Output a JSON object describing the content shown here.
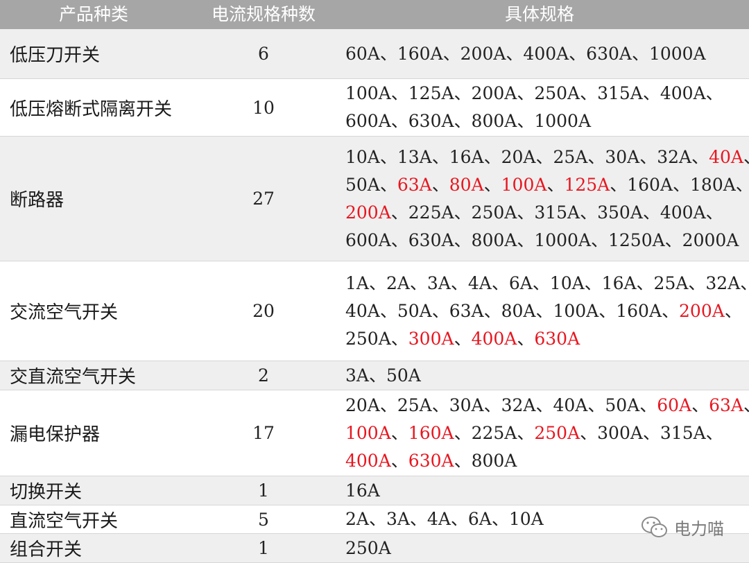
{
  "header": {
    "col_type": "产品种类",
    "col_count": "电流规格种数",
    "col_specs": "具体规格"
  },
  "rows": [
    {
      "name": "低压刀开关",
      "count": "6",
      "lines": [
        [
          [
            "60A、160A、200A、400A、630A、1000A",
            false
          ]
        ]
      ]
    },
    {
      "name": "低压熔断式隔离开关",
      "count": "10",
      "lines": [
        [
          [
            "100A、125A、200A、250A、315A、400A、",
            false
          ]
        ],
        [
          [
            "600A、630A、800A、1000A",
            false
          ]
        ]
      ]
    },
    {
      "name": "断路器",
      "count": "27",
      "lines": [
        [
          [
            "10A、13A、16A、20A、25A、30A、32A、",
            false
          ],
          [
            "40A",
            true
          ],
          [
            "、",
            false
          ]
        ],
        [
          [
            "50A、",
            false
          ],
          [
            "63A",
            true
          ],
          [
            "、",
            false
          ],
          [
            "80A",
            true
          ],
          [
            "、",
            false
          ],
          [
            "100A",
            true
          ],
          [
            "、",
            false
          ],
          [
            "125A",
            true
          ],
          [
            "、160A、180A、",
            false
          ]
        ],
        [
          [
            "200A",
            true
          ],
          [
            "、225A、250A、315A、350A、400A、",
            false
          ]
        ],
        [
          [
            "600A、630A、800A、1000A、1250A、2000A",
            false
          ]
        ]
      ]
    },
    {
      "name": "交流空气开关",
      "count": "20",
      "lines": [
        [
          [
            "1A、2A、3A、4A、6A、10A、16A、25A、32A、",
            false
          ]
        ],
        [
          [
            "40A、50A、63A、80A、100A、160A、",
            false
          ],
          [
            "200A",
            true
          ],
          [
            "、",
            false
          ]
        ],
        [
          [
            "250A、",
            false
          ],
          [
            "300A",
            true
          ],
          [
            "、",
            false
          ],
          [
            "400A",
            true
          ],
          [
            "、",
            false
          ],
          [
            "630A",
            true
          ]
        ]
      ]
    },
    {
      "name": "交直流空气开关",
      "count": "2",
      "lines": [
        [
          [
            "3A、50A",
            false
          ]
        ]
      ]
    },
    {
      "name": "漏电保护器",
      "count": "17",
      "lines": [
        [
          [
            "20A、25A、30A、32A、40A、50A、",
            false
          ],
          [
            "60A",
            true
          ],
          [
            "、",
            false
          ],
          [
            "63A",
            true
          ],
          [
            "、",
            false
          ]
        ],
        [
          [
            "100A",
            true
          ],
          [
            "、",
            false
          ],
          [
            "160A",
            true
          ],
          [
            "、225A、",
            false
          ],
          [
            "250A",
            true
          ],
          [
            "、300A、315A、",
            false
          ]
        ],
        [
          [
            "400A",
            true
          ],
          [
            "、",
            false
          ],
          [
            "630A",
            true
          ],
          [
            "、800A",
            false
          ]
        ]
      ]
    },
    {
      "name": "切换开关",
      "count": "1",
      "lines": [
        [
          [
            "16A",
            false
          ]
        ]
      ]
    },
    {
      "name": "直流空气开关",
      "count": "5",
      "lines": [
        [
          [
            "2A、3A、4A、6A、10A",
            false
          ]
        ]
      ]
    },
    {
      "name": "组合开关",
      "count": "1",
      "lines": [
        [
          [
            "250A",
            false
          ]
        ]
      ]
    }
  ],
  "colors": {
    "header_bg": "#a6a6a6",
    "alt_row_bg": "#efefef",
    "highlight": "#e8161f"
  },
  "watermark": {
    "icon": "wechat-icon",
    "text": "电力喵"
  }
}
